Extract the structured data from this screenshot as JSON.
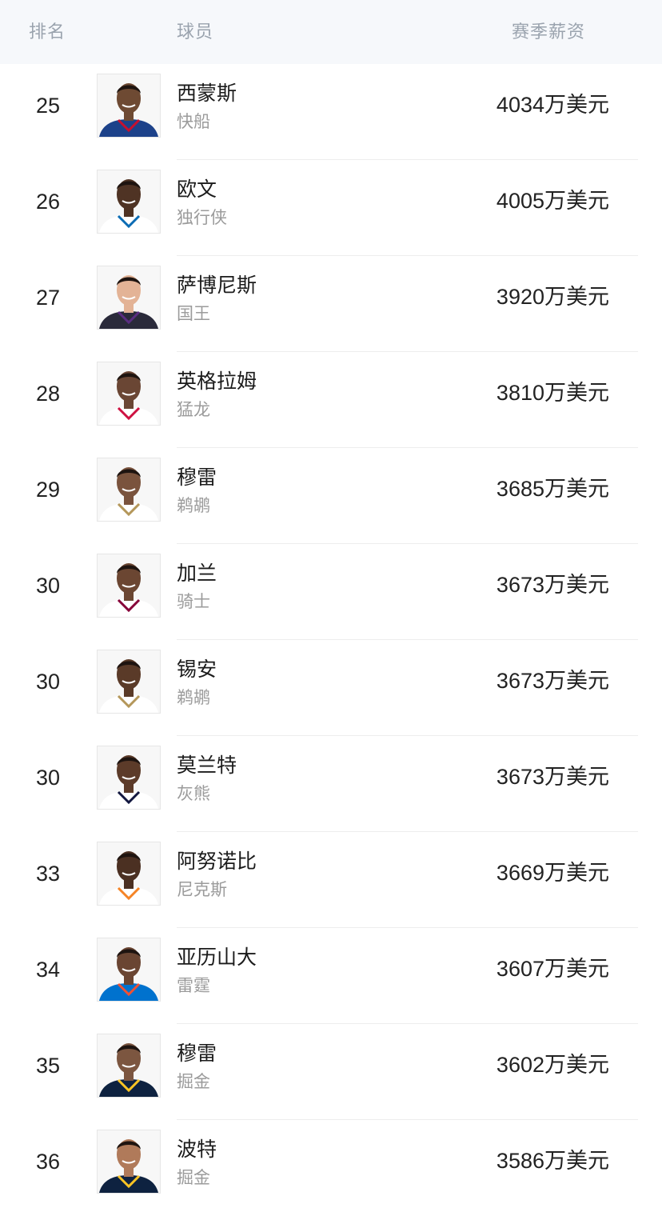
{
  "header": {
    "rank": "排名",
    "player": "球员",
    "salary": "赛季薪资"
  },
  "rows": [
    {
      "rank": "25",
      "name": "西蒙斯",
      "team": "快船",
      "salary": "4034万美元",
      "skin": "#6e4a33",
      "jersey": "#1d428a",
      "trim": "#c8102e"
    },
    {
      "rank": "26",
      "name": "欧文",
      "team": "独行侠",
      "salary": "4005万美元",
      "skin": "#4f3324",
      "jersey": "#ffffff",
      "trim": "#0b6cb4"
    },
    {
      "rank": "27",
      "name": "萨博尼斯",
      "team": "国王",
      "salary": "3920万美元",
      "skin": "#e3b396",
      "jersey": "#2a2a3a",
      "trim": "#5a2d81"
    },
    {
      "rank": "28",
      "name": "英格拉姆",
      "team": "猛龙",
      "salary": "3810万美元",
      "skin": "#6a4634",
      "jersey": "#ffffff",
      "trim": "#ce1141"
    },
    {
      "rank": "29",
      "name": "穆雷",
      "team": "鹈鹕",
      "salary": "3685万美元",
      "skin": "#7a533d",
      "jersey": "#ffffff",
      "trim": "#b4975a"
    },
    {
      "rank": "30",
      "name": "加兰",
      "team": "骑士",
      "salary": "3673万美元",
      "skin": "#6b4632",
      "jersey": "#ffffff",
      "trim": "#860038"
    },
    {
      "rank": "30",
      "name": "锡安",
      "team": "鹈鹕",
      "salary": "3673万美元",
      "skin": "#5a3a28",
      "jersey": "#ffffff",
      "trim": "#b4975a"
    },
    {
      "rank": "30",
      "name": "莫兰特",
      "team": "灰熊",
      "salary": "3673万美元",
      "skin": "#5c3b29",
      "jersey": "#ffffff",
      "trim": "#12173f"
    },
    {
      "rank": "33",
      "name": "阿努诺比",
      "team": "尼克斯",
      "salary": "3669万美元",
      "skin": "#4b3022",
      "jersey": "#ffffff",
      "trim": "#f58426"
    },
    {
      "rank": "34",
      "name": "亚历山大",
      "team": "雷霆",
      "salary": "3607万美元",
      "skin": "#6a4532",
      "jersey": "#0072ce",
      "trim": "#f05133"
    },
    {
      "rank": "35",
      "name": "穆雷",
      "team": "掘金",
      "salary": "3602万美元",
      "skin": "#7c5640",
      "jersey": "#0e2240",
      "trim": "#fec524"
    },
    {
      "rank": "36",
      "name": "波特",
      "team": "掘金",
      "salary": "3586万美元",
      "skin": "#b07a5a",
      "jersey": "#0e2240",
      "trim": "#fec524"
    }
  ]
}
